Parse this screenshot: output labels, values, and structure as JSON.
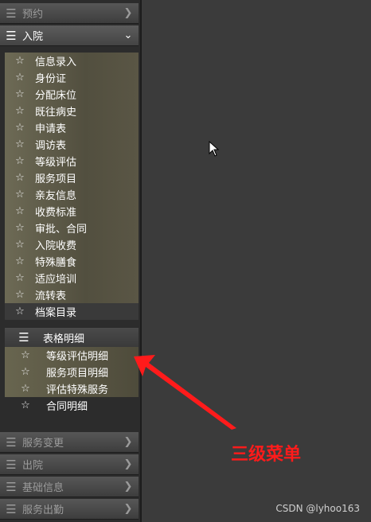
{
  "sidebar": {
    "yuyue": {
      "label": "预约"
    },
    "ruyuan": {
      "label": "入院"
    },
    "ruyuan_items": [
      "信息录入",
      "身份证",
      "分配床位",
      "既往病史",
      "申请表",
      "调访表",
      "等级评估",
      "服务项目",
      "亲友信息",
      "收费标准",
      "审批、合同",
      "入院收费",
      "特殊膳食",
      "适应培训",
      "流转表",
      "档案目录"
    ],
    "biaoge": {
      "label": "表格明细"
    },
    "biaoge_items": [
      "等级评估明细",
      "服务项目明细",
      "评估特殊服务",
      "合同明细"
    ],
    "bottom": [
      {
        "label": "服务变更"
      },
      {
        "label": "出院"
      },
      {
        "label": "基础信息"
      },
      {
        "label": "服务出勤"
      }
    ]
  },
  "annotation": "三级菜单",
  "watermark": "CSDN @lyhoo163",
  "colors": {
    "annotation": "#ff1b1b",
    "submenu_bg": "#6d6a55"
  },
  "icons": {
    "menu": "hamburger-icon",
    "item": "star-outline-icon",
    "collapsed": "chevron-right-icon",
    "expanded": "chevron-down-icon"
  }
}
